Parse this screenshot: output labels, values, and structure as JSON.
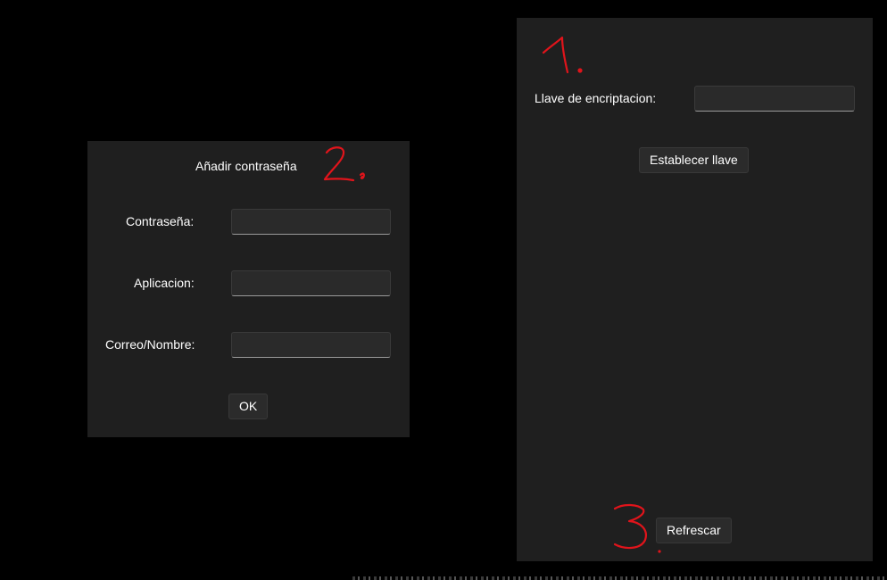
{
  "add_password_dialog": {
    "title": "Añadir contraseña",
    "fields": [
      {
        "label": "Contraseña:",
        "value": ""
      },
      {
        "label": "Aplicacion:",
        "value": ""
      },
      {
        "label": "Correo/Nombre:",
        "value": ""
      }
    ],
    "ok_label": "OK"
  },
  "key_panel": {
    "key_label": "Llave de encriptacion:",
    "key_value": "",
    "set_key_label": "Establecer llave",
    "refresh_label": "Refrescar"
  },
  "annotations": {
    "color": "#e0141b",
    "marks": [
      "1",
      "2",
      "3"
    ]
  },
  "colors": {
    "background": "#000000",
    "panel": "#1f1f1f",
    "input": "#2a2a2a",
    "button": "#2b2b2b",
    "text": "#ffffff"
  }
}
